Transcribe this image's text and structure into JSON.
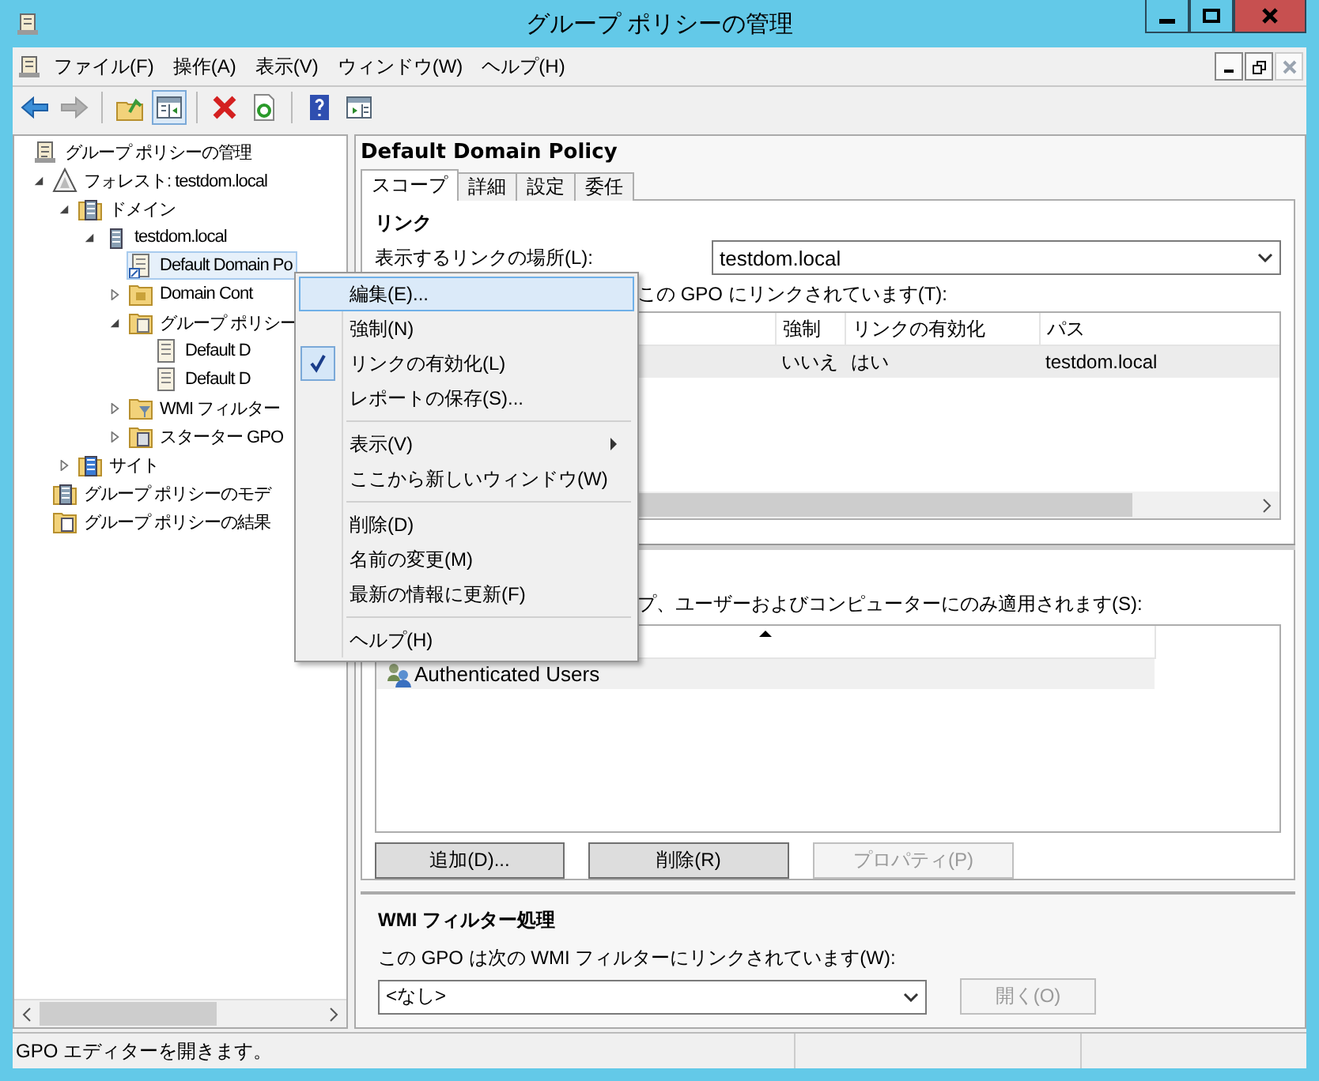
{
  "window": {
    "title": "グループ ポリシーの管理"
  },
  "menubar": [
    "ファイル(F)",
    "操作(A)",
    "表示(V)",
    "ウィンドウ(W)",
    "ヘルプ(H)"
  ],
  "toolbar": [
    {
      "kind": "back",
      "disabled": false,
      "pressed": false
    },
    {
      "kind": "forward",
      "disabled": true,
      "pressed": false
    },
    {
      "kind": "separator"
    },
    {
      "kind": "up",
      "disabled": false,
      "pressed": false
    },
    {
      "kind": "tree",
      "disabled": false,
      "pressed": true
    },
    {
      "kind": "separator"
    },
    {
      "kind": "delete",
      "disabled": false,
      "pressed": false
    },
    {
      "kind": "refresh",
      "disabled": false,
      "pressed": false
    },
    {
      "kind": "separator"
    },
    {
      "kind": "help",
      "disabled": false,
      "pressed": false
    },
    {
      "kind": "pane",
      "disabled": false,
      "pressed": false
    }
  ],
  "tree": {
    "label": "グループ ポリシーの管理",
    "kind": "console",
    "selected": false,
    "children": [
      {
        "label": "フォレスト: testdom.local",
        "kind": "forest",
        "selected": false,
        "expanded": true,
        "children": [
          {
            "label": "ドメイン",
            "kind": "domains",
            "selected": false,
            "expanded": true,
            "children": [
              {
                "label": "testdom.local",
                "kind": "domain",
                "selected": false,
                "expanded": true,
                "children": [
                  {
                    "label": "Default Domain Po",
                    "kind": "gpo-link",
                    "selected": true
                  },
                  {
                    "label": "Domain Cont",
                    "kind": "ou",
                    "selected": false,
                    "expanded": false
                  },
                  {
                    "label": "グループ ポリシー",
                    "kind": "gpo-folder",
                    "selected": false,
                    "expanded": true,
                    "children": [
                      {
                        "label": "Default D",
                        "kind": "gpo",
                        "selected": false
                      },
                      {
                        "label": "Default D",
                        "kind": "gpo",
                        "selected": false
                      }
                    ]
                  },
                  {
                    "label": "WMI フィルター",
                    "kind": "wmi",
                    "selected": false,
                    "expanded": false
                  },
                  {
                    "label": "スターター GPO",
                    "kind": "starter",
                    "selected": false,
                    "expanded": false
                  }
                ]
              }
            ]
          },
          {
            "label": "サイト",
            "kind": "sites",
            "selected": false,
            "expanded": false
          }
        ]
      },
      {
        "label": "グループ ポリシーのモデ",
        "kind": "modeling",
        "selected": false
      },
      {
        "label": "グループ ポリシーの結果",
        "kind": "results",
        "selected": false
      }
    ]
  },
  "details": {
    "title": "Default Domain Policy",
    "tabs": [
      {
        "label": "スコープ",
        "selected": true
      },
      {
        "label": "詳細",
        "selected": false
      },
      {
        "label": "設定",
        "selected": false
      },
      {
        "label": "委任",
        "selected": false
      }
    ],
    "links": {
      "heading": "リンク",
      "location_label": "表示するリンクの場所(L):",
      "location_value": "testdom.local",
      "linked_label": "この GPO にリンクされています(T):",
      "columns": [
        "強制",
        "リンクの有効化",
        "パス"
      ],
      "rows": [
        {
          "cells": [
            "いいえ",
            "はい",
            "testdom.local"
          ],
          "selected": true
        }
      ]
    },
    "security": {
      "label": "プ、ユーザーおよびコンピューターにのみ適用されます(S):",
      "rows": [
        {
          "name": "Authenticated Users",
          "selected": true
        }
      ],
      "buttons": [
        {
          "label": "追加(D)...",
          "disabled": false
        },
        {
          "label": "削除(R)",
          "disabled": false
        },
        {
          "label": "プロパティ(P)",
          "disabled": true
        }
      ]
    },
    "wmi": {
      "heading": "WMI フィルター処理",
      "label": "この GPO は次の WMI フィルターにリンクされています(W):",
      "value": "<なし>",
      "button": {
        "label": "開く(O)",
        "disabled": true
      }
    }
  },
  "context_menu": [
    {
      "kind": "item",
      "label": "編集(E)...",
      "selected": true,
      "checked": false,
      "submenu": false
    },
    {
      "kind": "item",
      "label": "強制(N)",
      "selected": false,
      "checked": false,
      "submenu": false
    },
    {
      "kind": "item",
      "label": "リンクの有効化(L)",
      "selected": false,
      "checked": true,
      "submenu": false
    },
    {
      "kind": "item",
      "label": "レポートの保存(S)...",
      "selected": false,
      "checked": false,
      "submenu": false
    },
    {
      "kind": "separator"
    },
    {
      "kind": "item",
      "label": "表示(V)",
      "selected": false,
      "checked": false,
      "submenu": true
    },
    {
      "kind": "item",
      "label": "ここから新しいウィンドウ(W)",
      "selected": false,
      "checked": false,
      "submenu": false
    },
    {
      "kind": "separator"
    },
    {
      "kind": "item",
      "label": "削除(D)",
      "selected": false,
      "checked": false,
      "submenu": false
    },
    {
      "kind": "item",
      "label": "名前の変更(M)",
      "selected": false,
      "checked": false,
      "submenu": false
    },
    {
      "kind": "item",
      "label": "最新の情報に更新(F)",
      "selected": false,
      "checked": false,
      "submenu": false
    },
    {
      "kind": "separator"
    },
    {
      "kind": "item",
      "label": "ヘルプ(H)",
      "selected": false,
      "checked": false,
      "submenu": false
    }
  ],
  "status_bar": {
    "text": "GPO エディターを開きます。"
  }
}
